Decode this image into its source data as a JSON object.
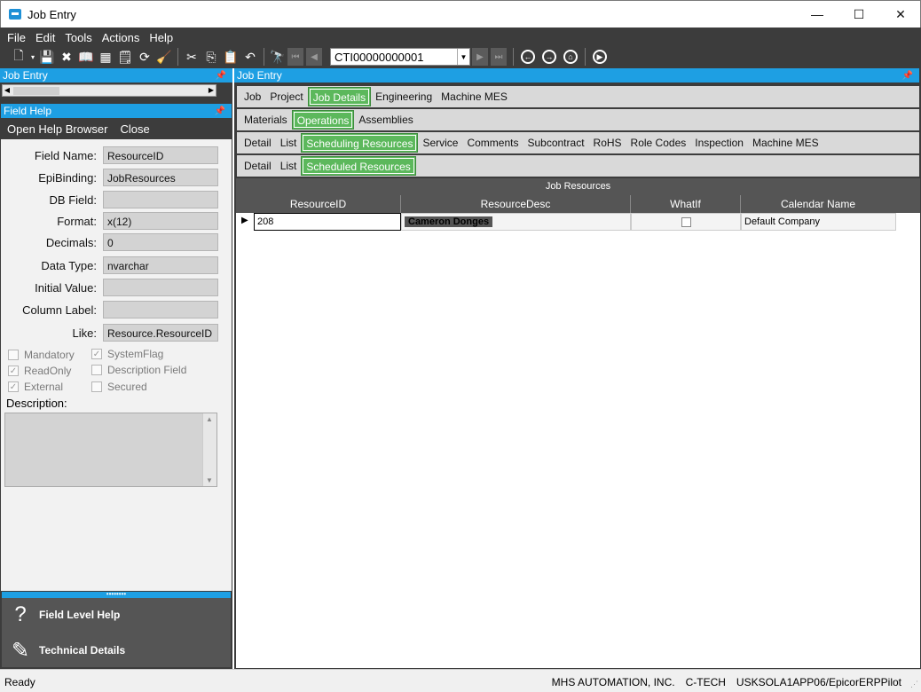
{
  "window": {
    "title": "Job Entry",
    "minimize": "—",
    "maximize": "☐",
    "close": "✕"
  },
  "menu": [
    "File",
    "Edit",
    "Tools",
    "Actions",
    "Help"
  ],
  "toolbar": {
    "job_number": "CTI00000000001"
  },
  "left_panel": {
    "title": "Job Entry"
  },
  "field_help": {
    "title": "Field Help",
    "actions": [
      "Open Help Browser",
      "Close"
    ],
    "fields": [
      {
        "label": "Field Name:",
        "value": "ResourceID"
      },
      {
        "label": "EpiBinding:",
        "value": "JobResources"
      },
      {
        "label": "DB Field:",
        "value": ""
      },
      {
        "label": "Format:",
        "value": "x(12)"
      },
      {
        "label": "Decimals:",
        "value": "0"
      },
      {
        "label": "Data Type:",
        "value": "nvarchar"
      },
      {
        "label": "Initial Value:",
        "value": ""
      },
      {
        "label": "Column Label:",
        "value": ""
      },
      {
        "label": "Like:",
        "value": "Resource.ResourceID"
      }
    ],
    "checkboxes": {
      "mandatory": "Mandatory",
      "systemflag": "SystemFlag",
      "readonly": "ReadOnly",
      "description_field": "Description Field",
      "external": "External",
      "secured": "Secured"
    },
    "description_label": "Description:",
    "bottom": {
      "field_level_help": "Field Level Help",
      "technical_details": "Technical Details"
    }
  },
  "right_panel": {
    "title": "Job Entry",
    "tabs1": [
      "Job",
      "Project",
      "Job Details",
      "Engineering",
      "Machine MES"
    ],
    "tabs2": [
      "Materials",
      "Operations",
      "Assemblies"
    ],
    "tabs3": [
      "Detail",
      "List",
      "Scheduling Resources",
      "Service",
      "Comments",
      "Subcontract",
      "RoHS",
      "Role Codes",
      "Inspection",
      "Machine MES"
    ],
    "tabs4": [
      "Detail",
      "List",
      "Scheduled Resources"
    ]
  },
  "grid": {
    "title": "Job Resources",
    "columns": [
      "ResourceID",
      "ResourceDesc",
      "WhatIf",
      "Calendar Name"
    ],
    "rows": [
      {
        "resource_id": "208",
        "resource_desc": "Cameron Donges",
        "calendar_name": "Default Company"
      }
    ]
  },
  "status": {
    "left": "Ready",
    "company": "MHS AUTOMATION, INC.",
    "site": "C-TECH",
    "server": "USKSOLA1APP06/EpicorERPPilot"
  }
}
